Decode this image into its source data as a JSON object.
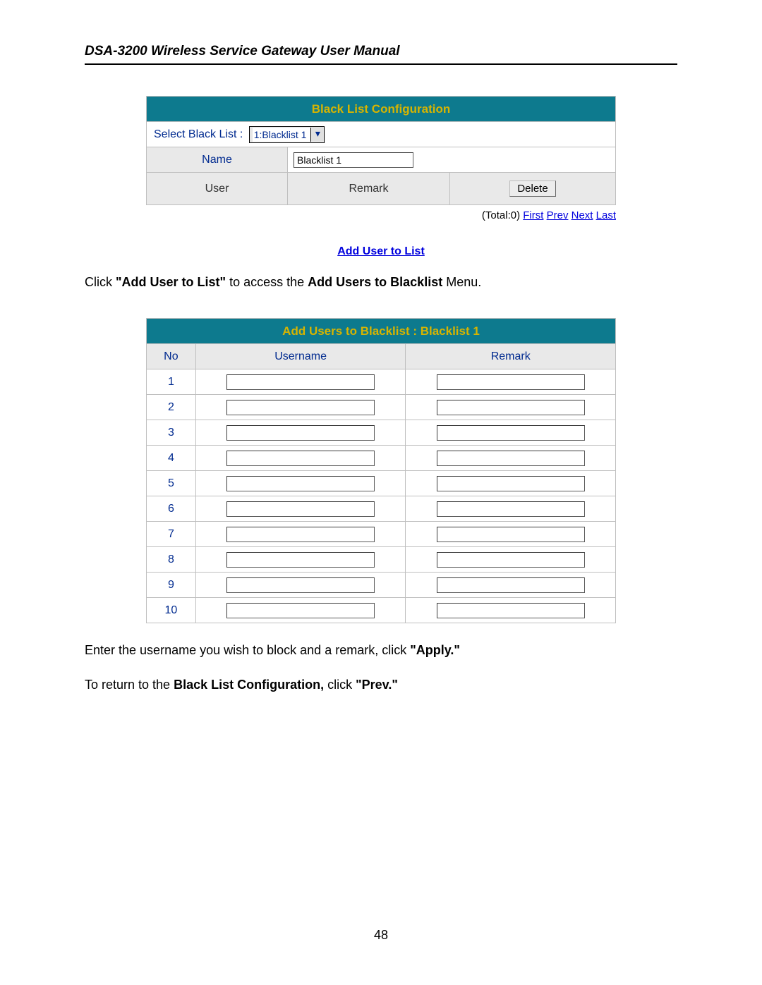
{
  "doc_title": "DSA-3200 Wireless Service Gateway User Manual",
  "page_number": "48",
  "config_table": {
    "title": "Black List Configuration",
    "select_label": "Select Black List :",
    "select_value": "1:Blacklist 1",
    "name_label": "Name",
    "name_value": "Blacklist 1",
    "col_user": "User",
    "col_remark": "Remark",
    "delete_btn": "Delete"
  },
  "pager": {
    "total": "(Total:0)",
    "first": "First",
    "prev": "Prev",
    "next": "Next",
    "last": "Last"
  },
  "add_user_link": "Add User to List",
  "para1": {
    "pre": "Click ",
    "b1": "\"Add User to List\"",
    "mid": " to access the ",
    "b2": "Add Users to Blacklist",
    "post": " Menu."
  },
  "add_table": {
    "title": "Add Users to Blacklist : Blacklist 1",
    "col_no": "No",
    "col_username": "Username",
    "col_remark": "Remark",
    "rows": [
      "1",
      "2",
      "3",
      "4",
      "5",
      "6",
      "7",
      "8",
      "9",
      "10"
    ]
  },
  "para2": {
    "pre": "Enter the username you wish to block and a remark, click ",
    "b1": "\"Apply.\""
  },
  "para3": {
    "pre": "To return to the ",
    "b1": "Black List Configuration,",
    "mid": " click ",
    "b2": "\"Prev.\""
  }
}
